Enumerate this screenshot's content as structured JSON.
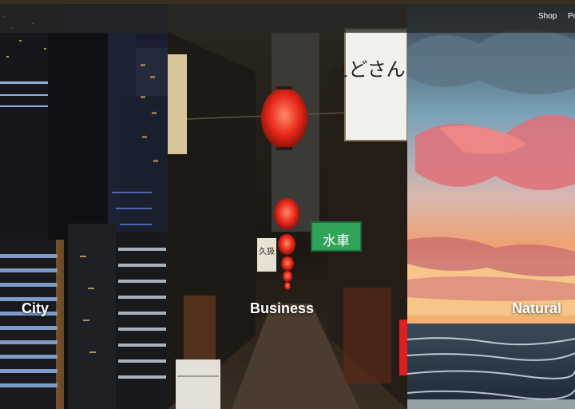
{
  "nav": {
    "links": [
      "Shop",
      "Po"
    ]
  },
  "categories": [
    {
      "label": "City"
    },
    {
      "label": "Business"
    },
    {
      "label": "Natural"
    }
  ],
  "signs": {
    "hanging_sign_text": "えどさんち",
    "green_sign_text": "水車",
    "vertical_sign_text": "久扱"
  }
}
